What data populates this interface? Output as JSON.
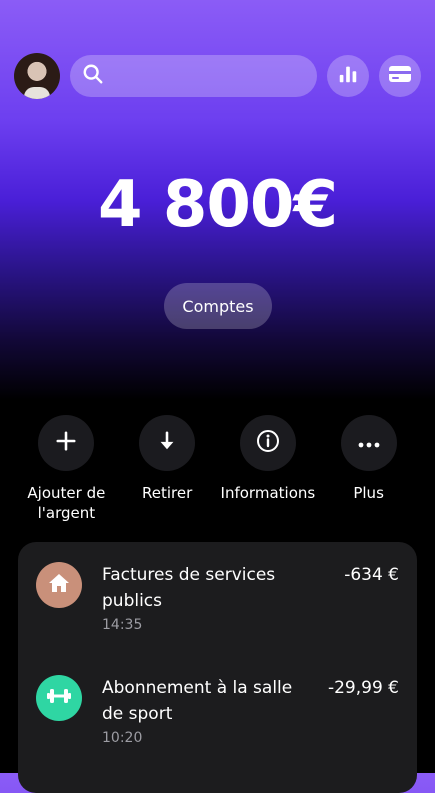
{
  "header": {
    "avatar_icon": "user-avatar",
    "search_icon": "search-icon",
    "stats_icon": "bar-chart-icon",
    "card_icon": "credit-card-icon"
  },
  "balance": "4 800€",
  "accounts_button": "Comptes",
  "actions": [
    {
      "label": "Ajouter de l'argent",
      "icon": "plus-icon"
    },
    {
      "label": "Retirer",
      "icon": "arrow-down-icon"
    },
    {
      "label": "Informations",
      "icon": "info-icon"
    },
    {
      "label": "Plus",
      "icon": "more-icon"
    }
  ],
  "transactions": [
    {
      "title": "Factures de services publics",
      "time": "14:35",
      "amount": "-634 €",
      "icon": "home-icon",
      "icon_color": "#c9907a"
    },
    {
      "title": "Abonnement à la salle de sport",
      "time": "10:20",
      "amount": "-29,99 €",
      "icon": "dumbbell-icon",
      "icon_color": "#2fd6a3"
    }
  ],
  "colors": {
    "gradient_top": "#8b5cf6",
    "gradient_mid": "#4a1fd8",
    "background": "#000000",
    "card": "#1c1c1e"
  }
}
